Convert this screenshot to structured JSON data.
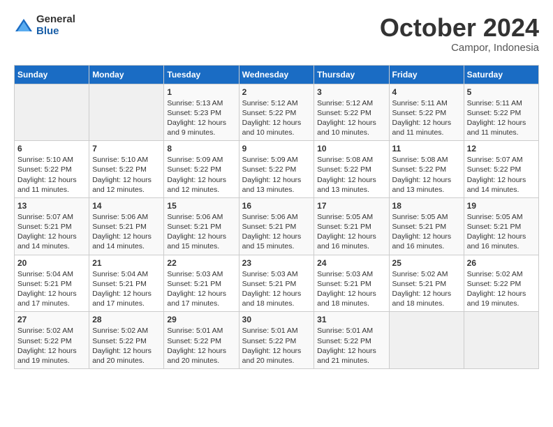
{
  "logo": {
    "general": "General",
    "blue": "Blue"
  },
  "title": "October 2024",
  "location": "Campor, Indonesia",
  "days_header": [
    "Sunday",
    "Monday",
    "Tuesday",
    "Wednesday",
    "Thursday",
    "Friday",
    "Saturday"
  ],
  "weeks": [
    [
      {
        "day": "",
        "info": ""
      },
      {
        "day": "",
        "info": ""
      },
      {
        "day": "1",
        "info": "Sunrise: 5:13 AM\nSunset: 5:23 PM\nDaylight: 12 hours and 9 minutes."
      },
      {
        "day": "2",
        "info": "Sunrise: 5:12 AM\nSunset: 5:22 PM\nDaylight: 12 hours and 10 minutes."
      },
      {
        "day": "3",
        "info": "Sunrise: 5:12 AM\nSunset: 5:22 PM\nDaylight: 12 hours and 10 minutes."
      },
      {
        "day": "4",
        "info": "Sunrise: 5:11 AM\nSunset: 5:22 PM\nDaylight: 12 hours and 11 minutes."
      },
      {
        "day": "5",
        "info": "Sunrise: 5:11 AM\nSunset: 5:22 PM\nDaylight: 12 hours and 11 minutes."
      }
    ],
    [
      {
        "day": "6",
        "info": "Sunrise: 5:10 AM\nSunset: 5:22 PM\nDaylight: 12 hours and 11 minutes."
      },
      {
        "day": "7",
        "info": "Sunrise: 5:10 AM\nSunset: 5:22 PM\nDaylight: 12 hours and 12 minutes."
      },
      {
        "day": "8",
        "info": "Sunrise: 5:09 AM\nSunset: 5:22 PM\nDaylight: 12 hours and 12 minutes."
      },
      {
        "day": "9",
        "info": "Sunrise: 5:09 AM\nSunset: 5:22 PM\nDaylight: 12 hours and 13 minutes."
      },
      {
        "day": "10",
        "info": "Sunrise: 5:08 AM\nSunset: 5:22 PM\nDaylight: 12 hours and 13 minutes."
      },
      {
        "day": "11",
        "info": "Sunrise: 5:08 AM\nSunset: 5:22 PM\nDaylight: 12 hours and 13 minutes."
      },
      {
        "day": "12",
        "info": "Sunrise: 5:07 AM\nSunset: 5:22 PM\nDaylight: 12 hours and 14 minutes."
      }
    ],
    [
      {
        "day": "13",
        "info": "Sunrise: 5:07 AM\nSunset: 5:21 PM\nDaylight: 12 hours and 14 minutes."
      },
      {
        "day": "14",
        "info": "Sunrise: 5:06 AM\nSunset: 5:21 PM\nDaylight: 12 hours and 14 minutes."
      },
      {
        "day": "15",
        "info": "Sunrise: 5:06 AM\nSunset: 5:21 PM\nDaylight: 12 hours and 15 minutes."
      },
      {
        "day": "16",
        "info": "Sunrise: 5:06 AM\nSunset: 5:21 PM\nDaylight: 12 hours and 15 minutes."
      },
      {
        "day": "17",
        "info": "Sunrise: 5:05 AM\nSunset: 5:21 PM\nDaylight: 12 hours and 16 minutes."
      },
      {
        "day": "18",
        "info": "Sunrise: 5:05 AM\nSunset: 5:21 PM\nDaylight: 12 hours and 16 minutes."
      },
      {
        "day": "19",
        "info": "Sunrise: 5:05 AM\nSunset: 5:21 PM\nDaylight: 12 hours and 16 minutes."
      }
    ],
    [
      {
        "day": "20",
        "info": "Sunrise: 5:04 AM\nSunset: 5:21 PM\nDaylight: 12 hours and 17 minutes."
      },
      {
        "day": "21",
        "info": "Sunrise: 5:04 AM\nSunset: 5:21 PM\nDaylight: 12 hours and 17 minutes."
      },
      {
        "day": "22",
        "info": "Sunrise: 5:03 AM\nSunset: 5:21 PM\nDaylight: 12 hours and 17 minutes."
      },
      {
        "day": "23",
        "info": "Sunrise: 5:03 AM\nSunset: 5:21 PM\nDaylight: 12 hours and 18 minutes."
      },
      {
        "day": "24",
        "info": "Sunrise: 5:03 AM\nSunset: 5:21 PM\nDaylight: 12 hours and 18 minutes."
      },
      {
        "day": "25",
        "info": "Sunrise: 5:02 AM\nSunset: 5:21 PM\nDaylight: 12 hours and 18 minutes."
      },
      {
        "day": "26",
        "info": "Sunrise: 5:02 AM\nSunset: 5:22 PM\nDaylight: 12 hours and 19 minutes."
      }
    ],
    [
      {
        "day": "27",
        "info": "Sunrise: 5:02 AM\nSunset: 5:22 PM\nDaylight: 12 hours and 19 minutes."
      },
      {
        "day": "28",
        "info": "Sunrise: 5:02 AM\nSunset: 5:22 PM\nDaylight: 12 hours and 20 minutes."
      },
      {
        "day": "29",
        "info": "Sunrise: 5:01 AM\nSunset: 5:22 PM\nDaylight: 12 hours and 20 minutes."
      },
      {
        "day": "30",
        "info": "Sunrise: 5:01 AM\nSunset: 5:22 PM\nDaylight: 12 hours and 20 minutes."
      },
      {
        "day": "31",
        "info": "Sunrise: 5:01 AM\nSunset: 5:22 PM\nDaylight: 12 hours and 21 minutes."
      },
      {
        "day": "",
        "info": ""
      },
      {
        "day": "",
        "info": ""
      }
    ]
  ]
}
